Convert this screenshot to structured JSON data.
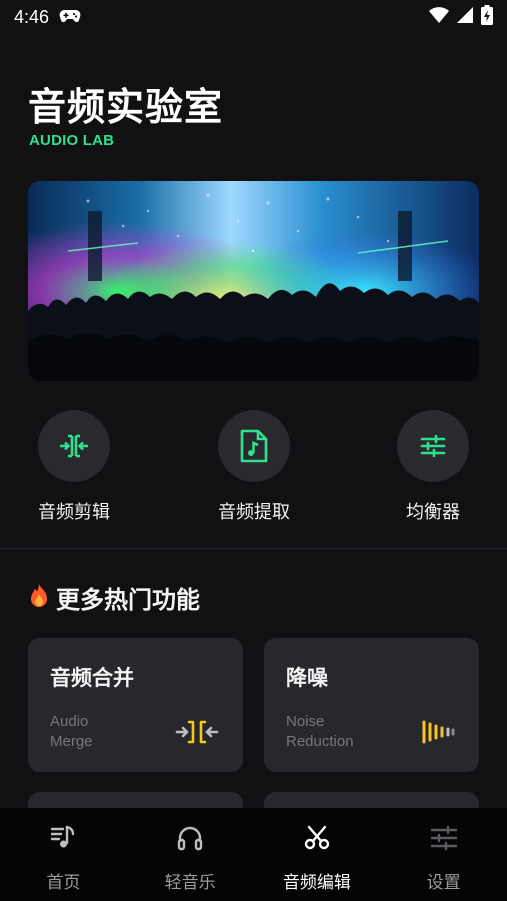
{
  "status_bar": {
    "time": "4:46",
    "icons": [
      "gamepad-icon",
      "wifi-icon",
      "signal-icon",
      "battery-charging-icon"
    ]
  },
  "header": {
    "title": "音频实验室",
    "subtitle": "AUDIO LAB"
  },
  "banner": {
    "image": "concert-crowd-stage-lights"
  },
  "quick_tools": [
    {
      "label": "音频剪辑",
      "icon": "audio-cut-icon"
    },
    {
      "label": "音频提取",
      "icon": "audio-file-icon"
    },
    {
      "label": "均衡器",
      "icon": "equalizer-icon"
    }
  ],
  "section": {
    "title": "更多热门功能",
    "icon": "fire-icon"
  },
  "feature_cards": [
    {
      "title": "音频合并",
      "subtitle_line1": "Audio",
      "subtitle_line2": "Merge",
      "icon": "merge-icon"
    },
    {
      "title": "降噪",
      "subtitle_line1": "Noise",
      "subtitle_line2": "Reduction",
      "icon": "noise-reduction-icon"
    }
  ],
  "bottom_nav": [
    {
      "label": "首页",
      "icon": "music-note-icon",
      "active": false
    },
    {
      "label": "轻音乐",
      "icon": "headphones-icon",
      "active": false
    },
    {
      "label": "音频编辑",
      "icon": "scissors-icon",
      "active": true
    },
    {
      "label": "设置",
      "icon": "sliders-icon",
      "active": false
    }
  ],
  "colors": {
    "background": "#111114",
    "accent_green": "#2fe08e",
    "accent_yellow": "#f3c623",
    "card": "#28282c",
    "nav_background": "#050506"
  }
}
